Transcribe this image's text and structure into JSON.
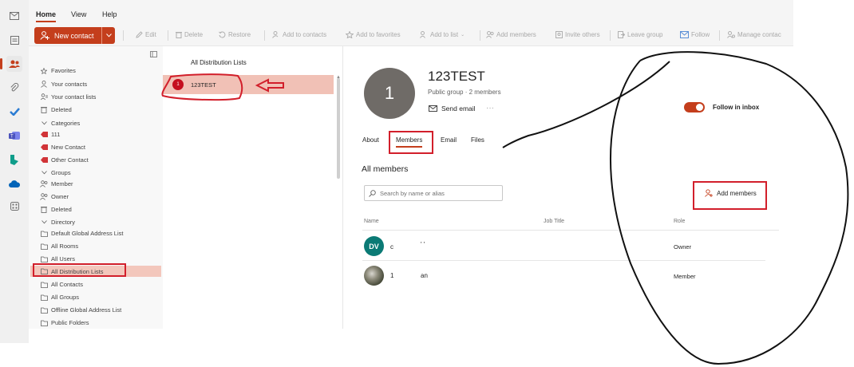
{
  "top_tabs": [
    "Home",
    "View",
    "Help"
  ],
  "toolbar": {
    "new_contact": "New contact",
    "items": [
      {
        "label": "Edit",
        "icon": "pencil-icon"
      },
      {
        "label": "Delete",
        "icon": "trash-icon"
      },
      {
        "label": "Restore",
        "icon": "restore-icon"
      },
      {
        "label": "Add to contacts",
        "icon": "add-contacts-icon"
      },
      {
        "label": "Add to favorites",
        "icon": "star-icon"
      },
      {
        "label": "Add to list",
        "icon": "add-list-icon"
      },
      {
        "label": "Add members",
        "icon": "add-members-icon"
      },
      {
        "label": "Invite others",
        "icon": "invite-icon"
      },
      {
        "label": "Leave group",
        "icon": "leave-icon"
      },
      {
        "label": "Follow",
        "icon": "follow-icon"
      },
      {
        "label": "Manage contac",
        "icon": "manage-icon"
      }
    ]
  },
  "nav": {
    "favorites": "Favorites",
    "your_contacts": "Your contacts",
    "your_contact_lists": "Your contact lists",
    "deleted": "Deleted",
    "categories": "Categories",
    "cat_111": "111",
    "cat_new_contact": "New Contact",
    "cat_other_contact": "Other Contact",
    "groups": "Groups",
    "group_member": "Member",
    "group_owner": "Owner",
    "group_deleted": "Deleted",
    "directory": "Directory",
    "dir_items": [
      "Default Global Address List",
      "All Rooms",
      "All Users",
      "All Distribution Lists",
      "All Contacts",
      "All Groups",
      "Offline Global Address List",
      "Public Folders"
    ]
  },
  "list": {
    "header": "All Distribution Lists",
    "item_initial": "1",
    "item_name": "123TEST"
  },
  "detail": {
    "avatar_initial": "1",
    "name": "123TEST",
    "subtitle": "Public group · 2 members",
    "send_email": "Send email",
    "more": "···",
    "follow_label": "Follow in inbox",
    "follow_on": true,
    "tabs": [
      "About",
      "Members",
      "Email",
      "Files"
    ],
    "active_tab": "Members",
    "section_title": "All members",
    "search_placeholder": "Search by name or alias",
    "add_members": "Add members",
    "columns": {
      "name": "Name",
      "job_title": "Job Title",
      "role": "Role"
    },
    "members": [
      {
        "initials": "DV",
        "name": "c",
        "name2": "' '",
        "role": "Owner",
        "avatar_color": "#0b7a75"
      },
      {
        "initials": "",
        "name": "1",
        "name2": "an",
        "role": "Member",
        "avatar_color": "#5b5f4a"
      }
    ]
  },
  "colors": {
    "accent": "#c43e1c",
    "annotation": "#d21f2b"
  }
}
